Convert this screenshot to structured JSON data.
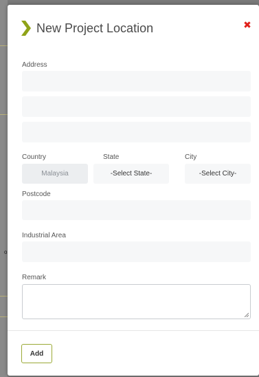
{
  "modal": {
    "title": "New Project Location",
    "close_icon": "close-icon",
    "accent_color": "#8fa318",
    "close_color": "#e0201a"
  },
  "form": {
    "address_label": "Address",
    "address_line1": "",
    "address_line2": "",
    "address_line3": "",
    "country_label": "Country",
    "country_value": "Malaysia",
    "state_label": "State",
    "state_value": "-Select State-",
    "city_label": "City",
    "city_value": "-Select City-",
    "postcode_label": "Postcode",
    "postcode_value": "",
    "industrial_area_label": "Industrial Area",
    "industrial_area_value": "",
    "remark_label": "Remark",
    "remark_value": ""
  },
  "footer": {
    "add_label": "Add"
  },
  "background": {
    "left_char": "o"
  }
}
